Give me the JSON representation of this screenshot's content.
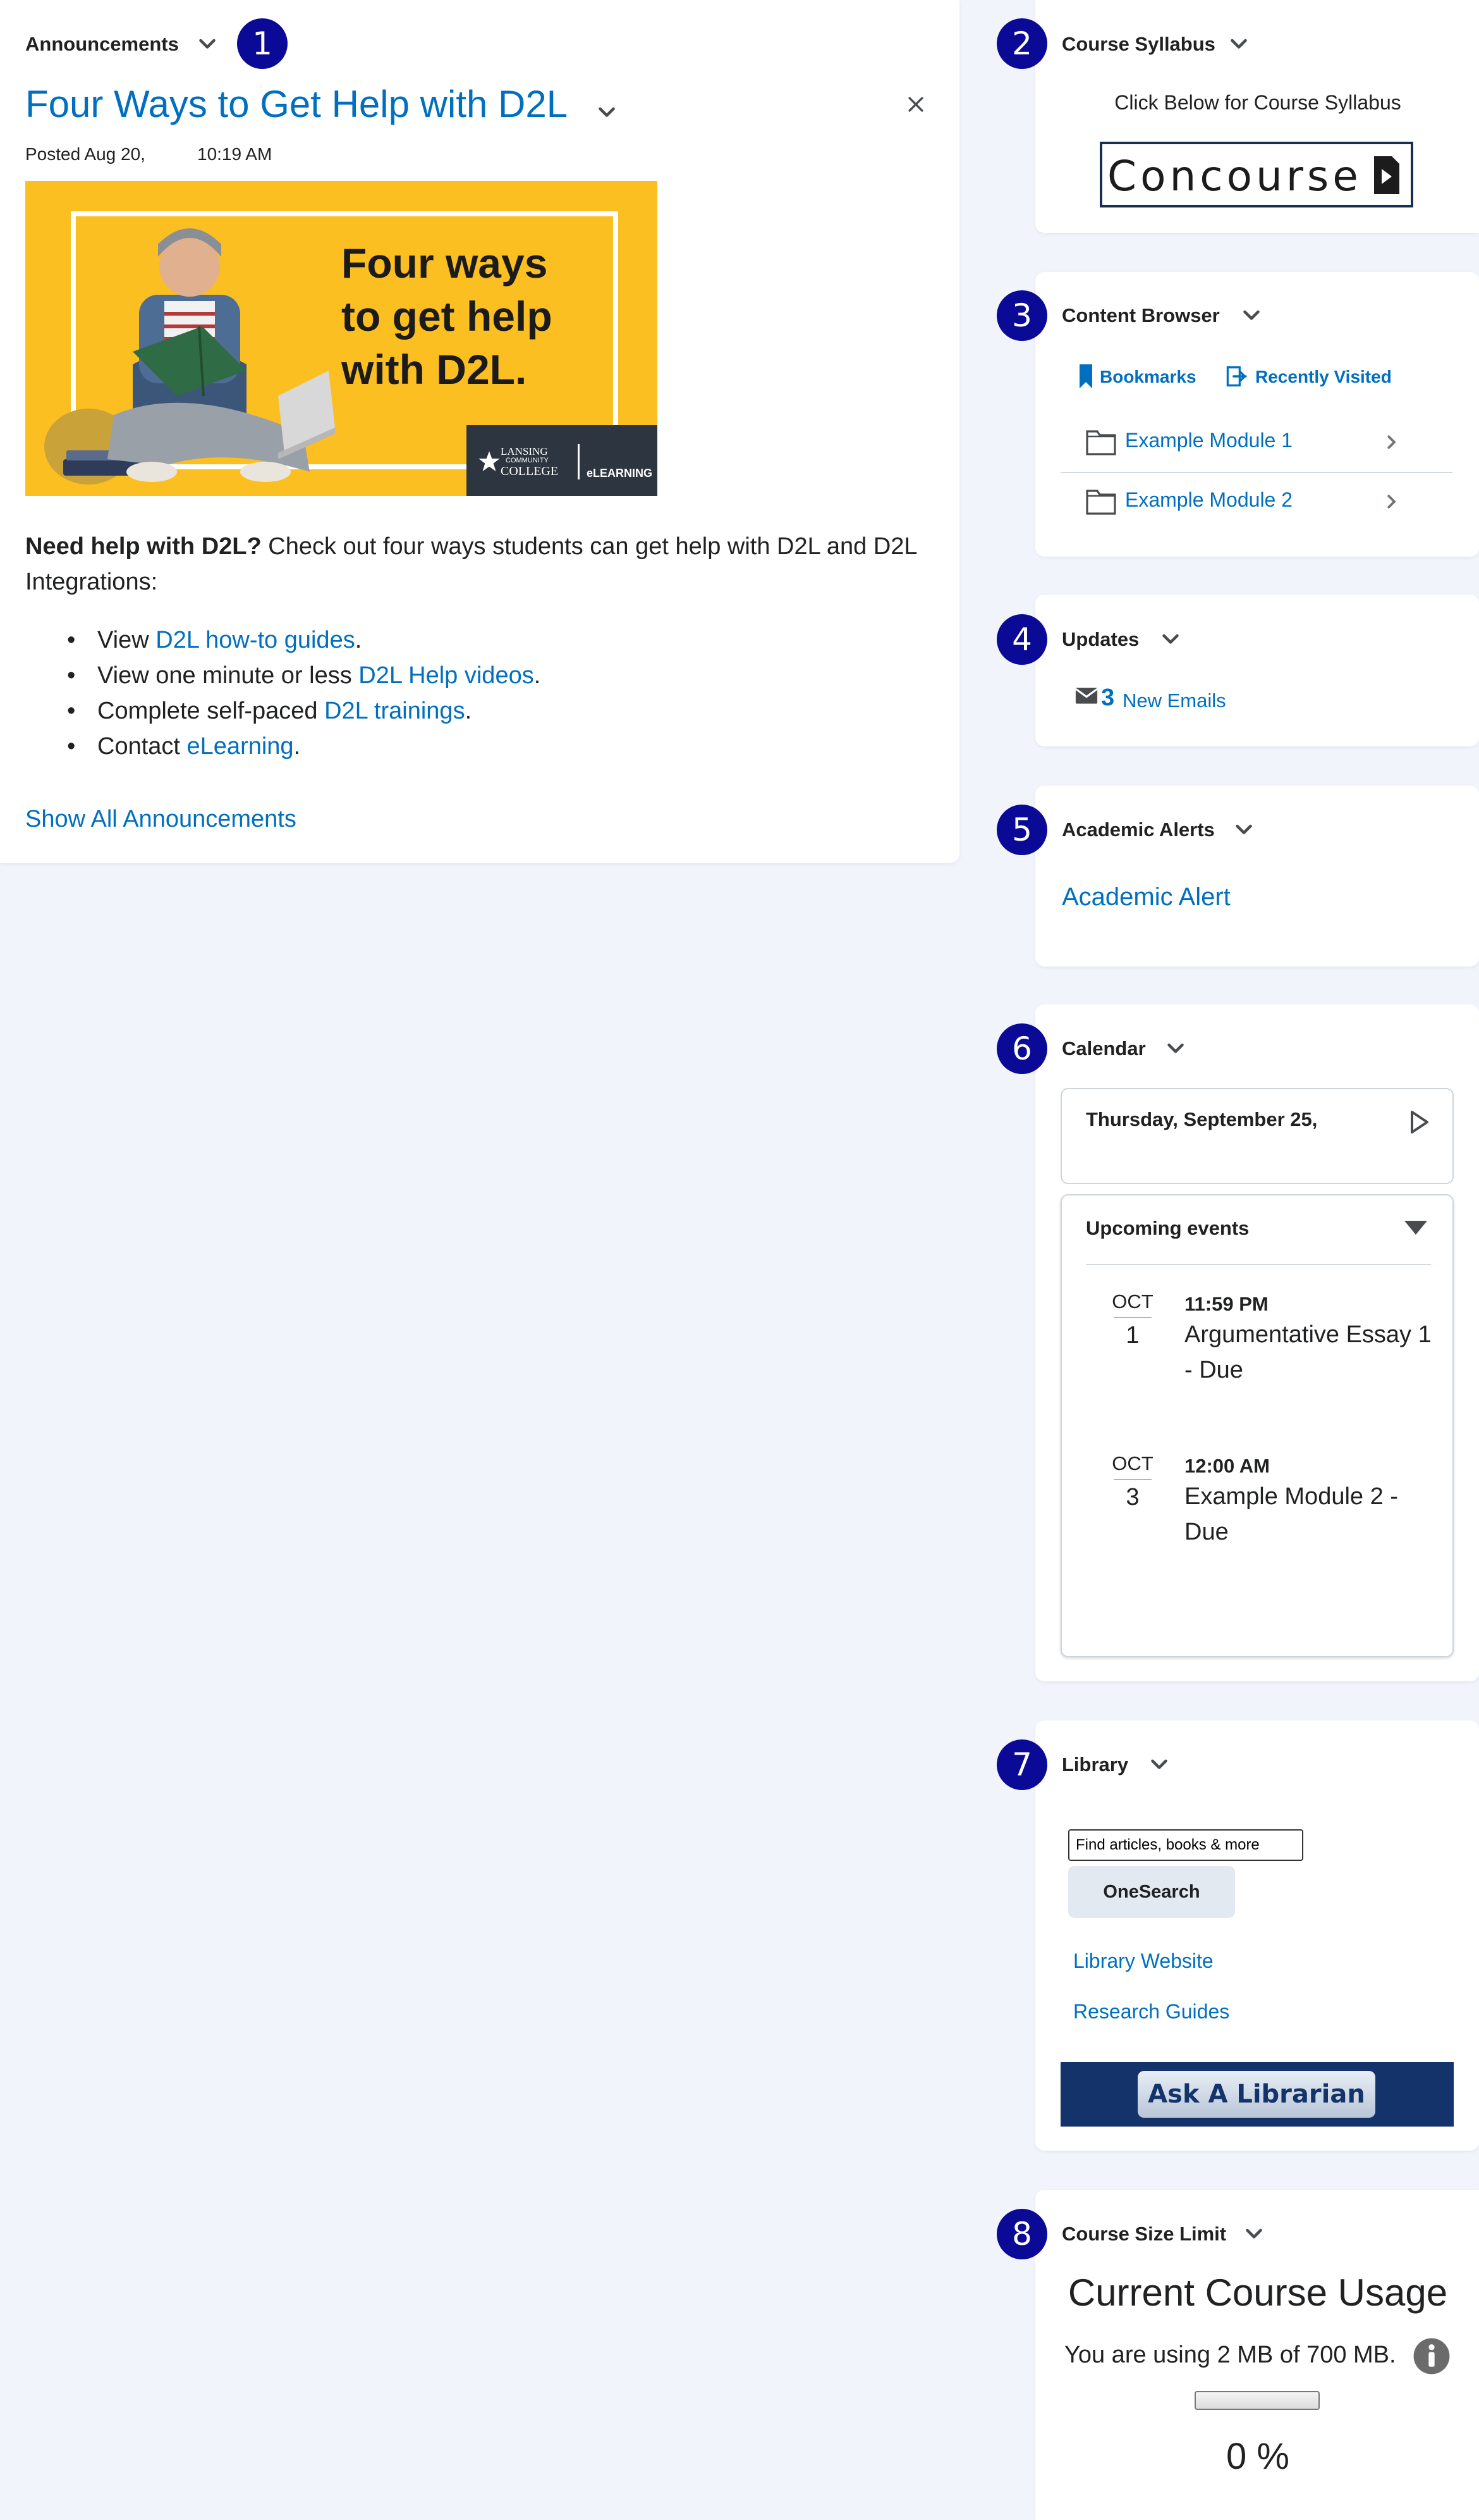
{
  "announcements": {
    "widget_title": "Announcements",
    "badge": "1",
    "post_title": "Four Ways to Get Help with D2L",
    "posted_label": "Posted Aug 20,",
    "posted_time": "10:19 AM",
    "hero_text": "Four ways\nto get help\nwith D2L.",
    "hero_logo_line1": "LANSING",
    "hero_logo_line2": "COMMUNITY",
    "hero_logo_line3": "COLLEGE",
    "hero_logo_right": "eLEARNING",
    "body_bold": "Need help with D2L?",
    "body_rest": " Check out four ways students can get help with D2L and D2L Integrations:",
    "bullets": [
      {
        "prefix": "View ",
        "link": "D2L how-to guides",
        "suffix": "."
      },
      {
        "prefix": "View one minute or less ",
        "link": "D2L Help videos",
        "suffix": "."
      },
      {
        "prefix": "Complete self-paced ",
        "link": "D2L trainings",
        "suffix": "."
      },
      {
        "prefix": "Contact ",
        "link": "eLearning",
        "suffix": "."
      }
    ],
    "show_all": "Show All Announcements"
  },
  "syllabus": {
    "widget_title": "Course Syllabus",
    "badge": "2",
    "caption": "Click Below for Course Syllabus",
    "logo_text": "Concourse"
  },
  "content_browser": {
    "widget_title": "Content Browser",
    "badge": "3",
    "bookmarks": "Bookmarks",
    "recently_visited": "Recently Visited",
    "modules": [
      "Example Module 1",
      "Example Module 2"
    ]
  },
  "updates": {
    "widget_title": "Updates",
    "badge": "4",
    "count": "3",
    "label": "New Emails"
  },
  "academic_alerts": {
    "widget_title": "Academic Alerts",
    "badge": "5",
    "link": "Academic Alert"
  },
  "calendar": {
    "widget_title": "Calendar",
    "badge": "6",
    "date": "Thursday, September 25,",
    "upcoming_label": "Upcoming events",
    "events": [
      {
        "month": "OCT",
        "day": "1",
        "time": "11:59 PM",
        "title": "Argumentative Essay 1 - Due"
      },
      {
        "month": "OCT",
        "day": "3",
        "time": "12:00 AM",
        "title": "Example Module 2 - Due"
      }
    ]
  },
  "library": {
    "widget_title": "Library",
    "badge": "7",
    "search_value": "Find articles, books & more",
    "search_button": "OneSearch",
    "links": [
      "Library Website",
      "Research Guides"
    ],
    "ask_button": "Ask A Librarian"
  },
  "course_size": {
    "widget_title": "Course Size Limit",
    "badge": "8",
    "heading": "Current Course Usage",
    "usage_text": "You are using 2 MB of 700 MB.",
    "usage_fraction": 0.0,
    "percent_text": "0 %"
  },
  "colors": {
    "page_bg": "#f1f5fb",
    "link": "#006fbf",
    "badge": "#0a0a96",
    "hero_bg": "#fcbf21",
    "ask_banner": "#14336b"
  }
}
